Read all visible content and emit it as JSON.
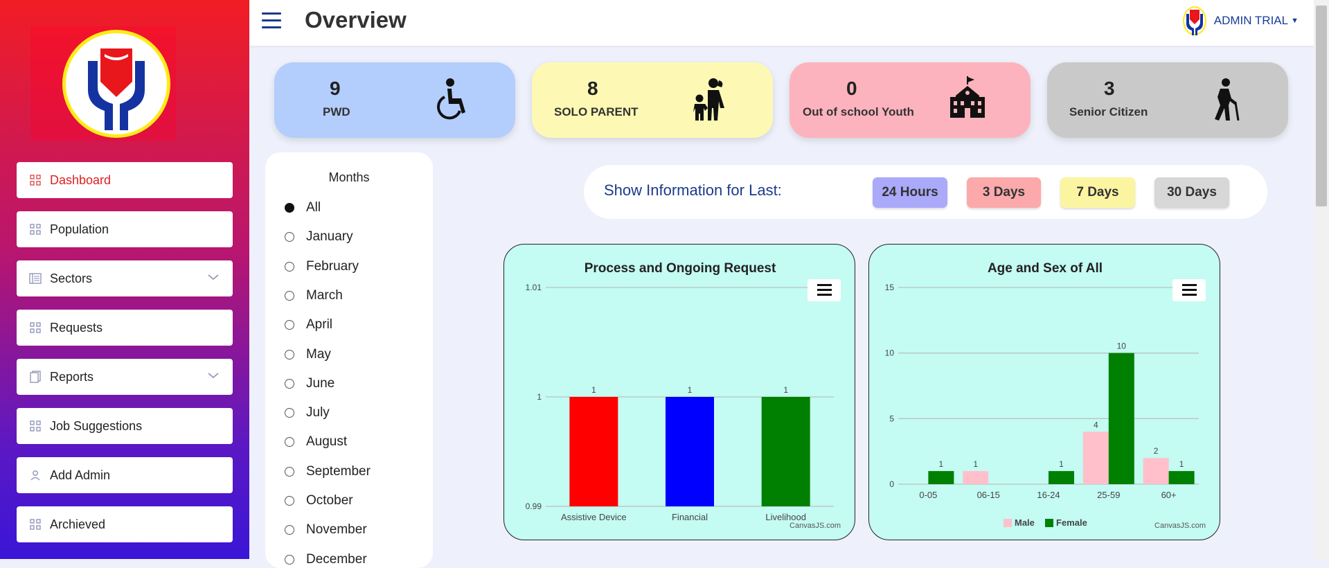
{
  "header": {
    "title": "Overview",
    "user": "ADMIN TRIAL"
  },
  "sidebar": {
    "items": [
      {
        "label": "Dashboard",
        "icon": "grid-icon",
        "active": true
      },
      {
        "label": "Population",
        "icon": "grid-icon"
      },
      {
        "label": "Sectors",
        "icon": "list-icon",
        "dropdown": true
      },
      {
        "label": "Requests",
        "icon": "grid-icon"
      },
      {
        "label": "Reports",
        "icon": "document-icon",
        "dropdown": true
      },
      {
        "label": "Job Suggestions",
        "icon": "grid-icon"
      },
      {
        "label": "Add Admin",
        "icon": "user-icon"
      },
      {
        "label": "Archieved",
        "icon": "grid-icon"
      }
    ]
  },
  "stats": [
    {
      "value": "9",
      "label": "PWD",
      "icon": "wheelchair-icon",
      "color": "#b3cdfc"
    },
    {
      "value": "8",
      "label": "SOLO PARENT",
      "icon": "parent-child-icon",
      "color": "#fdf9b4"
    },
    {
      "value": "0",
      "label": "Out of school Youth",
      "icon": "school-icon",
      "color": "#fdb3bd"
    },
    {
      "value": "3",
      "label": "Senior Citizen",
      "icon": "elderly-icon",
      "color": "#c9c9c9"
    }
  ],
  "months": {
    "title": "Months",
    "options": [
      "All",
      "January",
      "February",
      "March",
      "April",
      "May",
      "June",
      "July",
      "August",
      "September",
      "October",
      "November",
      "December"
    ],
    "selected": "All"
  },
  "filter": {
    "label": "Show Information for Last:",
    "buttons": [
      {
        "label": "24 Hours",
        "color": "#aaa9fa"
      },
      {
        "label": "3 Days",
        "color": "#fca9ab"
      },
      {
        "label": "7 Days",
        "color": "#fbf5a2"
      },
      {
        "label": "30 Days",
        "color": "#d7d7d7"
      }
    ]
  },
  "credit": "CanvasJS.com",
  "chart_data": [
    {
      "type": "bar",
      "title": "Process and Ongoing Request",
      "categories": [
        "Assistive Device",
        "Financial",
        "Livelihood"
      ],
      "values": [
        1,
        1,
        1
      ],
      "colors": [
        "#ff0000",
        "#0000ff",
        "#008000"
      ],
      "ylim": [
        0.99,
        1.01
      ],
      "yticks": [
        "0.99",
        "1",
        "1.01"
      ],
      "grid": true
    },
    {
      "type": "bar",
      "title": "Age and Sex of All",
      "categories": [
        "0-05",
        "06-15",
        "16-24",
        "25-59",
        "60+"
      ],
      "series": [
        {
          "name": "Male",
          "values": [
            0,
            1,
            0,
            4,
            2
          ],
          "color": "#ffc0cb"
        },
        {
          "name": "Female",
          "values": [
            1,
            0,
            1,
            10,
            1
          ],
          "color": "#008000"
        }
      ],
      "ylim": [
        0,
        15
      ],
      "yticks": [
        "0",
        "5",
        "10",
        "15"
      ],
      "legend": "bottom",
      "grid": true
    }
  ]
}
